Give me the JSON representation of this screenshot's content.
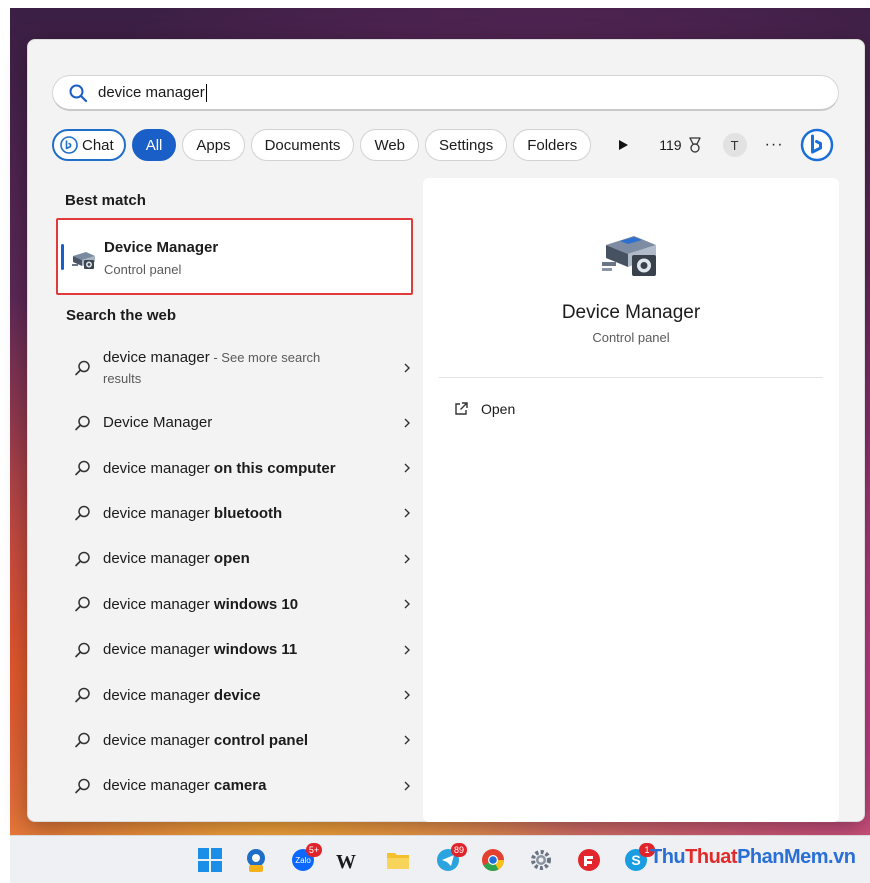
{
  "search": {
    "query": "device manager"
  },
  "filters": {
    "chips": [
      {
        "label": "Chat",
        "active": false
      },
      {
        "label": "All",
        "active": true
      },
      {
        "label": "Apps",
        "active": false
      },
      {
        "label": "Documents",
        "active": false
      },
      {
        "label": "Web",
        "active": false
      },
      {
        "label": "Settings",
        "active": false
      },
      {
        "label": "Folders",
        "active": false
      }
    ],
    "points": "119",
    "avatar_initial": "T",
    "more": "···"
  },
  "best_match": {
    "heading": "Best match",
    "title": "Device Manager",
    "subtitle": "Control panel"
  },
  "web": {
    "heading": "Search the web",
    "items": [
      {
        "prefix": "device manager",
        "bold": "",
        "hint": " - See more search",
        "hint2": "results"
      },
      {
        "prefix": "Device Manager",
        "bold": "",
        "hint": "",
        "hint2": ""
      },
      {
        "prefix": "device manager ",
        "bold": "on this computer",
        "hint": "",
        "hint2": ""
      },
      {
        "prefix": "device manager ",
        "bold": "bluetooth",
        "hint": "",
        "hint2": ""
      },
      {
        "prefix": "device manager ",
        "bold": "open",
        "hint": "",
        "hint2": ""
      },
      {
        "prefix": "device manager ",
        "bold": "windows 10",
        "hint": "",
        "hint2": ""
      },
      {
        "prefix": "device manager ",
        "bold": "windows 11",
        "hint": "",
        "hint2": ""
      },
      {
        "prefix": "device manager ",
        "bold": "device",
        "hint": "",
        "hint2": ""
      },
      {
        "prefix": "device manager ",
        "bold": "control panel",
        "hint": "",
        "hint2": ""
      },
      {
        "prefix": "device manager ",
        "bold": "camera",
        "hint": "",
        "hint2": ""
      }
    ]
  },
  "preview": {
    "title": "Device Manager",
    "subtitle": "Control panel",
    "actions": [
      {
        "label": "Open"
      }
    ]
  },
  "taskbar": {
    "badges": {
      "zalo": "5+",
      "telegram": "89",
      "skype": "1"
    }
  },
  "watermark": {
    "part1": "Thu",
    "part2": "Thuat",
    "part3": "PhanMem.vn"
  },
  "colors": {
    "accent": "#1a5fc7",
    "highlight_border": "#e03a3a"
  }
}
